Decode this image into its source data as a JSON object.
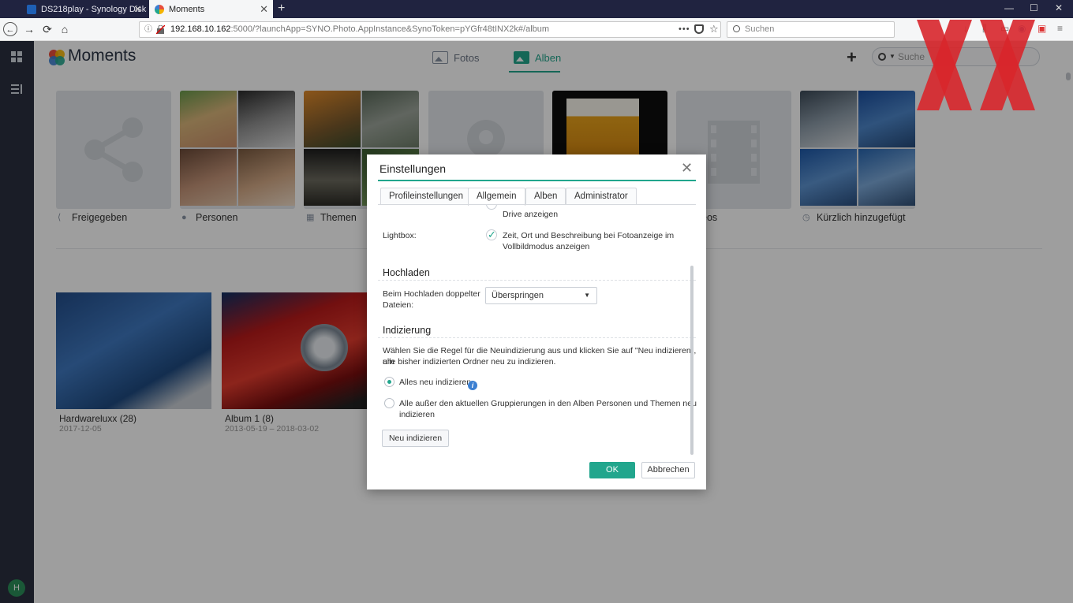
{
  "browser": {
    "tabs": [
      {
        "title": "DS218play - Synology DiskStati",
        "close": "✕"
      },
      {
        "title": "Moments",
        "close": "✕"
      }
    ],
    "new_tab": "+",
    "url_host": "192.168.10.162",
    "url_rest": ":5000/?launchApp=SYNO.Photo.AppInstance&SynoToken=pYGfr48tINX2k#/album",
    "search_placeholder": "Suchen",
    "window_controls": [
      "—",
      "☐",
      "✕"
    ]
  },
  "sidebar": {
    "avatar_initial": "H"
  },
  "app": {
    "title": "Moments",
    "tabs": [
      {
        "label": "Fotos",
        "icon": "photo-icon"
      },
      {
        "label": "Alben",
        "icon": "album-icon"
      }
    ],
    "active_tab": "Alben",
    "add": "+",
    "search_placeholder": "Suche",
    "smart_albums": [
      {
        "label": "Freigegeben",
        "icon": "share-icon"
      },
      {
        "label": "Personen",
        "icon": "person-icon"
      },
      {
        "label": "Themen",
        "icon": "grid-icon"
      },
      {
        "label": "",
        "icon": "location-icon"
      },
      {
        "label": "",
        "icon": "bookmark-icon"
      },
      {
        "label": "eos",
        "icon": "video-icon"
      },
      {
        "label": "Kürzlich hinzugefügt",
        "icon": "clock-icon"
      }
    ],
    "albums": [
      {
        "name": "Hardwareluxx (28)",
        "date": "2017-12-05"
      },
      {
        "name": "Album 1 (8)",
        "date": "2013-05-19 – 2018-03-02"
      }
    ]
  },
  "dialog": {
    "title": "Einstellungen",
    "close": "✕",
    "tabs": [
      "Profileinstellungen",
      "Allgemein",
      "Alben",
      "Administrator"
    ],
    "active_tab": "Allgemein",
    "cut_text": "Drive anzeigen",
    "lightbox_label": "Lightbox:",
    "lightbox_checkbox": "Zeit, Ort und Beschreibung bei Fotoanzeige im",
    "lightbox_checkbox_2": "Vollbildmodus anzeigen",
    "upload_section": "Hochladen",
    "duplicate_label_1": "Beim Hochladen doppelter",
    "duplicate_label_2": "Dateien:",
    "duplicate_value": "Überspringen",
    "index_section": "Indizierung",
    "index_desc_1": "Wählen Sie die Regel für die Neuindizierung aus und klicken Sie auf \"Neu indizieren\", um",
    "index_desc_2": "alle bisher indizierten Ordner neu zu indizieren.",
    "option_all": "Alles neu indizieren",
    "option_except_1": "Alle außer den aktuellen Gruppierungen in den Alben Personen und Themen neu",
    "option_except_2": "indizieren",
    "selected_option": "Alles neu indizieren",
    "reindex_button": "Neu indizieren",
    "ok": "OK",
    "cancel": "Abbrechen"
  },
  "colors": {
    "accent": "#22a68d",
    "browser_bar": "#202340",
    "sidebar": "#2a3040",
    "watermark": "#d8262b"
  }
}
